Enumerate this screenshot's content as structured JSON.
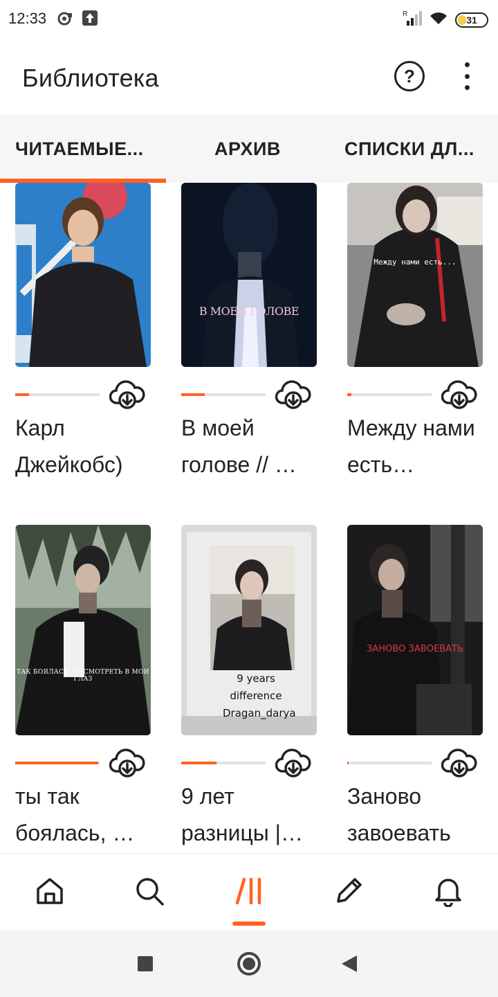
{
  "status_bar": {
    "time": "12:33",
    "battery": "31",
    "icons": [
      "sync-icon",
      "upload-icon",
      "signal-icon",
      "wifi-icon",
      "battery-icon"
    ]
  },
  "app_bar": {
    "title": "Библиотека",
    "help_label": "?",
    "icons": [
      "help-icon",
      "more-vertical-icon"
    ]
  },
  "tabs": [
    {
      "label": "ЧИТАЕМЫЕ...",
      "active": true
    },
    {
      "label": "АРХИВ",
      "active": false
    },
    {
      "label": "СПИСКИ ДЛ...",
      "active": false
    }
  ],
  "stories": [
    {
      "title": "Карл Джейкобс)",
      "progress": 0.16,
      "cover_text": "",
      "cover_theme": "blue"
    },
    {
      "title": "В моей голове // …",
      "progress": 0.28,
      "cover_text": "В МОЕЙ ГОЛОВЕ",
      "cover_theme": "dark"
    },
    {
      "title": "Между нами есть…",
      "progress": 0.05,
      "cover_text": "Между нами есть...",
      "cover_theme": "grey"
    },
    {
      "title": "ты так боялась, …",
      "progress": 0.98,
      "cover_text": "ТАК БОЯЛАСЬ, ПОСМОТРЕТЬ В МОИ ГЛАЗ",
      "cover_theme": "forest"
    },
    {
      "title": "9 лет разницы |…",
      "progress": 0.42,
      "cover_text": "9 years difference Dragan_darya",
      "cover_theme": "light"
    },
    {
      "title": "Заново завоевать",
      "progress": 0.02,
      "cover_text": "ЗАНОВО ЗАВОЕВАТЬ",
      "cover_theme": "night"
    }
  ],
  "bottom_nav": [
    {
      "name": "home",
      "icon": "home-icon",
      "active": false
    },
    {
      "name": "search",
      "icon": "search-icon",
      "active": false
    },
    {
      "name": "library",
      "icon": "library-icon",
      "active": true
    },
    {
      "name": "write",
      "icon": "pencil-icon",
      "active": false
    },
    {
      "name": "notifications",
      "icon": "bell-icon",
      "active": false
    }
  ],
  "colors": {
    "accent": "#ff6122",
    "text": "#222222",
    "tabs_background": "#f6f6f6"
  }
}
